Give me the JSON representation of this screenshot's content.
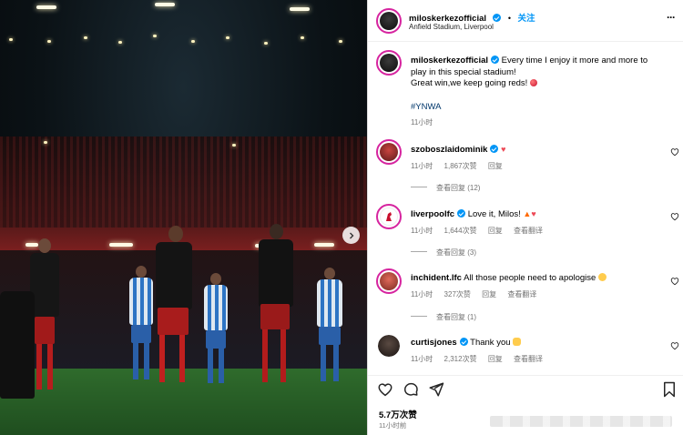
{
  "post": {
    "author": "miloskerkezofficial",
    "follow_label": "关注",
    "location": "Anfield Stadium, Liverpool",
    "more_label": "···",
    "caption_line1": "Every time I enjoy it more and more to",
    "caption_line2": "play in this special stadium!",
    "caption_line3": "Great win,we keep going reds!",
    "hashtag": "#YNWA",
    "caption_time": "11小时",
    "likes": "5.7万次赞",
    "posted_ago": "11小时前"
  },
  "comments": [
    {
      "user": "szoboszlaidominik",
      "text": "",
      "emoji": "heart",
      "time": "11小时",
      "likes": "1,867次赞",
      "reply": "回复",
      "translate": "",
      "view_replies": "查看回复 (12)"
    },
    {
      "user": "liverpoolfc",
      "text": "Love it, Milos!",
      "emoji": "fire-heart",
      "time": "11小时",
      "likes": "1,644次赞",
      "reply": "回复",
      "translate": "查看翻译",
      "view_replies": "查看回复 (3)"
    },
    {
      "user": "inchident.lfc",
      "text": "All those people need to apologise",
      "emoji": "laugh",
      "time": "11小时",
      "likes": "327次赞",
      "reply": "回复",
      "translate": "查看翻译",
      "view_replies": "查看回复 (1)"
    },
    {
      "user": "curtisjones",
      "text": "Thank you",
      "emoji": "clap",
      "time": "11小时",
      "likes": "2,312次赞",
      "reply": "回复",
      "translate": "查看翻译",
      "view_replies": ""
    }
  ],
  "icons": [
    "heart-icon",
    "comment-icon",
    "share-icon",
    "bookmark-icon",
    "verified-icon",
    "more-icon",
    "chevron-right-icon"
  ],
  "colors": {
    "accent": "#0095f6",
    "like": "#ed4956",
    "border": "#dbdbdb",
    "muted": "#737373"
  }
}
